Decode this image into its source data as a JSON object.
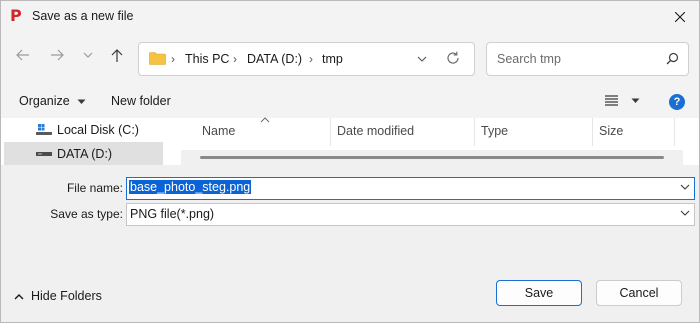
{
  "window": {
    "title": "Save as a new file",
    "app_icon": "P"
  },
  "nav": {
    "breadcrumbs": [
      "This PC",
      "DATA (D:)",
      "tmp"
    ],
    "search_placeholder": "Search tmp"
  },
  "command_bar": {
    "organize_label": "Organize",
    "new_folder_label": "New folder",
    "help_label": "?"
  },
  "nav_pane": {
    "items": [
      {
        "label": "Local Disk (C:)",
        "icon": "windows-drive-icon",
        "selected": false
      },
      {
        "label": "DATA (D:)",
        "icon": "drive-icon",
        "selected": true
      }
    ]
  },
  "file_list": {
    "columns": [
      "Name",
      "Date modified",
      "Type",
      "Size"
    ],
    "rows": []
  },
  "form": {
    "file_name_label": "File name:",
    "file_name_value": "base_photo_steg.png",
    "save_as_type_label": "Save as type:",
    "save_as_type_value": "PNG file(*.png)"
  },
  "footer": {
    "hide_folders_label": "Hide Folders",
    "save_label": "Save",
    "cancel_label": "Cancel"
  },
  "colors": {
    "accent": "#1a6fd3",
    "app_icon": "#d1262b",
    "selection": "#0a64d6",
    "folder": "#f5c242"
  }
}
